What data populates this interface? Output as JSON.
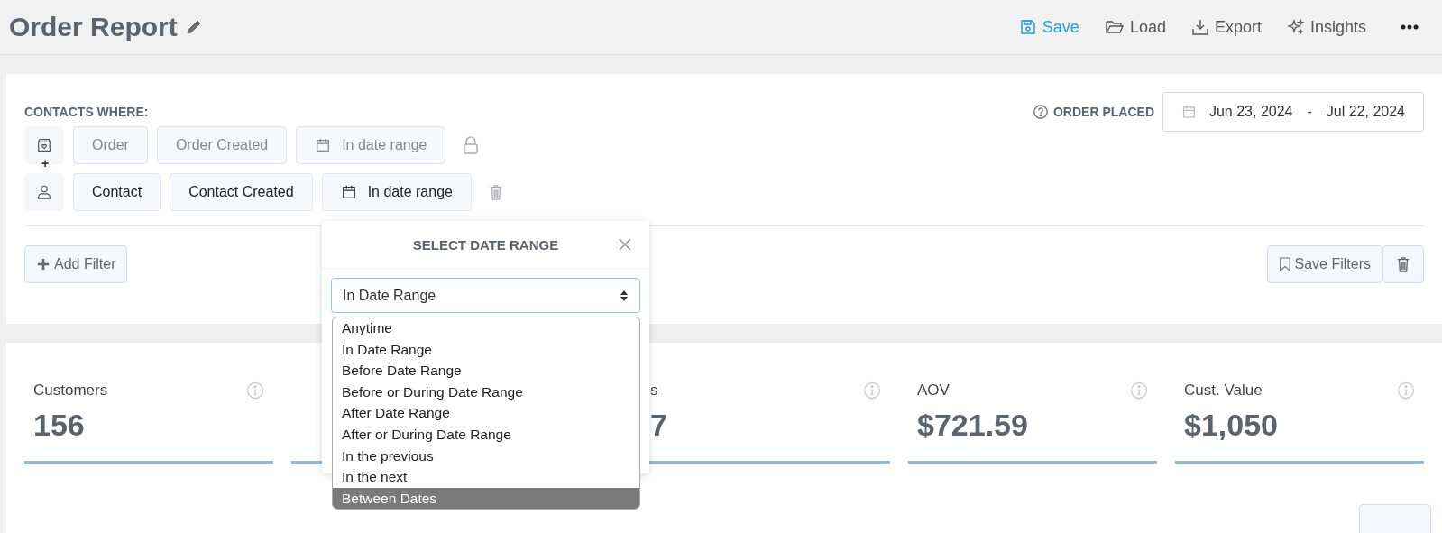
{
  "header": {
    "title": "Order Report",
    "actions": [
      {
        "label": "Save",
        "selected": true
      },
      {
        "label": "Load",
        "selected": false
      },
      {
        "label": "Export",
        "selected": false
      },
      {
        "label": "Insights",
        "selected": false
      }
    ]
  },
  "filters": {
    "heading": "CONTACTS WHERE:",
    "date_label": "ORDER PLACED",
    "date_from": "Jun 23, 2024",
    "date_sep": "-",
    "date_to": "Jul 22, 2024",
    "join": "+",
    "rows": [
      {
        "field": "Order",
        "property": "Order Created",
        "condition": "In date range",
        "locked": true,
        "disabled": true
      },
      {
        "field": "Contact",
        "property": "Contact Created",
        "condition": "In date range",
        "locked": false,
        "disabled": false
      }
    ],
    "add_button": "Add Filter",
    "save_button": "Save Filters"
  },
  "popup": {
    "title": "SELECT DATE RANGE",
    "select_value": "In Date Range",
    "options": [
      {
        "label": "Anytime",
        "selected": false
      },
      {
        "label": "In Date Range",
        "selected": false
      },
      {
        "label": "Before Date Range",
        "selected": false
      },
      {
        "label": "Before or During Date Range",
        "selected": false
      },
      {
        "label": "After Date Range",
        "selected": false
      },
      {
        "label": "After or During Date Range",
        "selected": false
      },
      {
        "label": "In the previous",
        "selected": false
      },
      {
        "label": "In the next",
        "selected": false
      },
      {
        "label": "Between Dates",
        "selected": true
      }
    ]
  },
  "stats": [
    {
      "kind": "full",
      "label": "Customers",
      "value": "156"
    },
    {
      "kind": "covered"
    },
    {
      "kind": "partial",
      "label": "s",
      "value": "7"
    },
    {
      "kind": "full",
      "label": "AOV",
      "value": "$721.59"
    },
    {
      "kind": "full",
      "label": "Cust. Value",
      "value": "$1,050"
    }
  ]
}
